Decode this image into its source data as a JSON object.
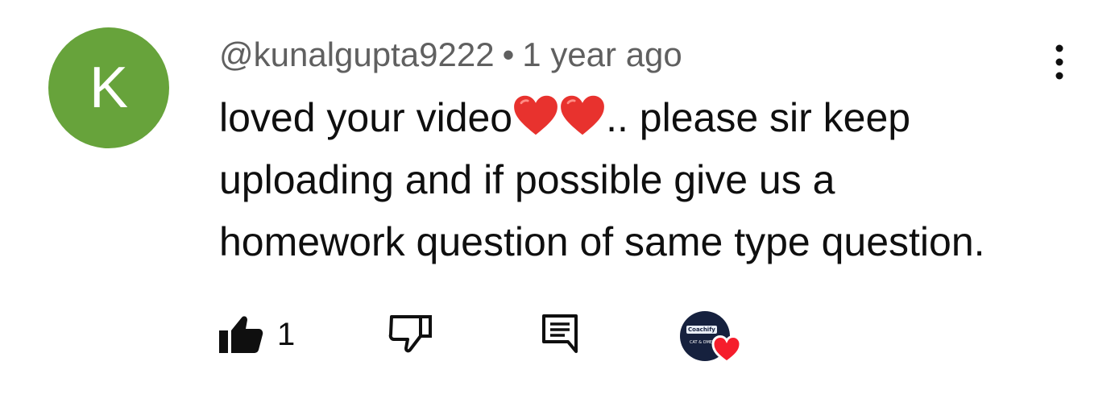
{
  "comment": {
    "author_initial": "K",
    "avatar_color": "#67a33b",
    "author_handle": "@kunalgupta9222",
    "separator": "•",
    "timestamp": "1 year ago",
    "text_part1": "loved your  video",
    "text_part2": ".. please sir keep",
    "text_line2": "uploading and if possible give us a",
    "text_line3": "homework question of same type question.",
    "emoji": "heart-emoji x2"
  },
  "actions": {
    "like_count": "1",
    "like_icon": "thumbs-up-filled-icon",
    "dislike_icon": "thumbs-down-outline-icon",
    "reply_icon": "reply-comment-icon",
    "more_icon": "more-vertical-icon"
  },
  "creator_heart": {
    "channel_brand": "Coachify",
    "channel_sub": "CAT & OMET",
    "heart_color": "#f51d2c"
  }
}
